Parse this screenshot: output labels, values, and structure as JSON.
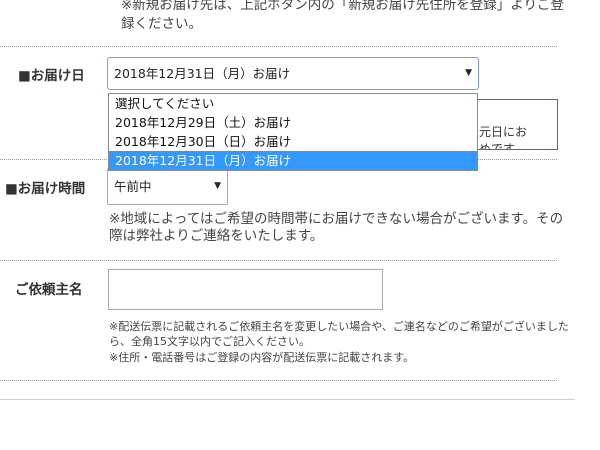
{
  "top_note": "※新規お届け先は、上記ボタン内の「新規お届け先住所を登録」よりご登録ください。",
  "delivery_date": {
    "label": "■お届け日",
    "selected": "2018年12月31日（月）お届け",
    "options": [
      "選択してください",
      "2018年12月29日（土）お届け",
      "2018年12月30日（日）お届け",
      "2018年12月31日（月）お届け"
    ],
    "notice": "元日にお\nめです。"
  },
  "delivery_time": {
    "label": "■お届け時間",
    "selected": "午前中",
    "note": "※地域によってはご希望の時間帯にお届けできない場合がございます。その際は弊社よりご連絡をいたします。"
  },
  "requester": {
    "label": "ご依頼主名",
    "value": "",
    "note1": "※配送伝票に記載されるご依頼主名を変更したい場合や、ご連名などのご希望がございましたら、全角15文字以内でご記入ください。",
    "note2": "※住所・電話番号はご登録の内容が配送伝票に記載されます。"
  },
  "colors": {
    "highlight": "#3399ff",
    "focus_border": "#7b9fcf",
    "warning_border": "#d33a3a"
  },
  "icons": {
    "dropdown_arrow": "▼"
  }
}
